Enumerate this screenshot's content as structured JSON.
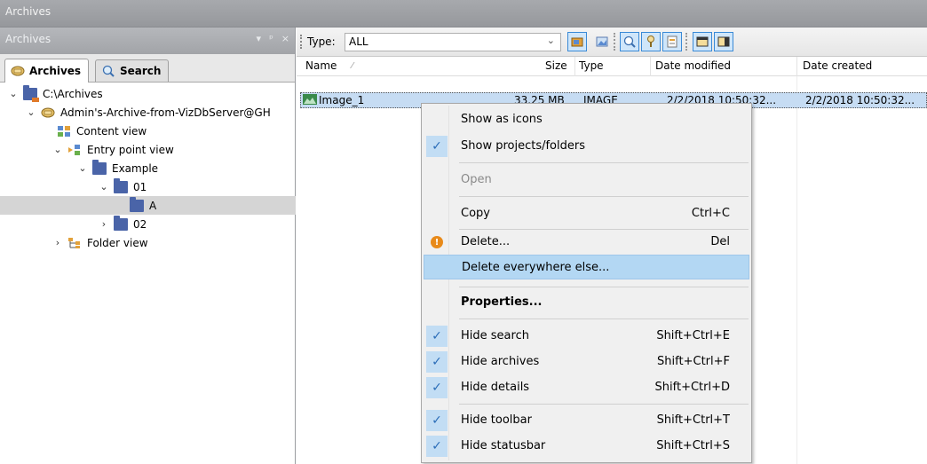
{
  "window": {
    "title": "Archives"
  },
  "left_panel": {
    "header_title": "Archives",
    "header_buttons": [
      "▾",
      "ᵖ",
      "×"
    ],
    "tabs": [
      {
        "label": "Archives",
        "icon": "archive-icon"
      },
      {
        "label": "Search",
        "icon": "search-icon"
      }
    ],
    "tree": [
      {
        "label": "C:\\Archives",
        "chevron": "⌄",
        "icon": "drive-folder-icon"
      },
      {
        "label": "Admin's-Archive-from-VizDbServer@GH",
        "chevron": "⌄",
        "icon": "archive-icon"
      },
      {
        "label": "Content view",
        "chevron": "",
        "icon": "content-view-icon"
      },
      {
        "label": "Entry point view",
        "chevron": "⌄",
        "icon": "entry-point-icon"
      },
      {
        "label": "Example",
        "chevron": "⌄",
        "icon": "folder-icon"
      },
      {
        "label": "01",
        "chevron": "⌄",
        "icon": "folder-icon"
      },
      {
        "label": "A",
        "chevron": "",
        "icon": "folder-icon",
        "selected": true
      },
      {
        "label": "02",
        "chevron": "›",
        "icon": "folder-icon"
      },
      {
        "label": "Folder view",
        "chevron": "›",
        "icon": "folder-view-icon"
      }
    ]
  },
  "toolbar": {
    "type_label": "Type:",
    "type_value": "ALL",
    "buttons": [
      "show-projects-icon",
      "thumbnail-icon",
      "search-icon",
      "filter-icon",
      "properties-icon",
      "hide-archives-icon",
      "hide-details-icon"
    ]
  },
  "columns": {
    "name": "Name",
    "size": "Size",
    "type": "Type",
    "date_modified": "Date modified",
    "date_created": "Date created"
  },
  "files": [
    {
      "name": "Image_1",
      "size": "33.25 MB",
      "type": "IMAGE",
      "date_modified": "2/2/2018 10:50:32...",
      "date_created": "2/2/2018 10:50:32..."
    }
  ],
  "context_menu": {
    "items": [
      {
        "label": "Show as icons",
        "shortcut": "",
        "checked": false
      },
      {
        "label": "Show projects/folders",
        "shortcut": "",
        "checked": true
      },
      {
        "label": "Open",
        "shortcut": "",
        "checked": false,
        "disabled": true
      },
      {
        "label": "Copy",
        "shortcut": "Ctrl+C",
        "checked": false
      },
      {
        "label": "Delete...",
        "shortcut": "Del",
        "checked": false,
        "icon": "delete-icon"
      },
      {
        "label": "Delete everywhere else...",
        "shortcut": "",
        "checked": false,
        "hover": true
      },
      {
        "label": "Properties...",
        "shortcut": "",
        "checked": false,
        "bold": true
      },
      {
        "label": "Hide search",
        "shortcut": "Shift+Ctrl+E",
        "checked": true
      },
      {
        "label": "Hide archives",
        "shortcut": "Shift+Ctrl+F",
        "checked": true
      },
      {
        "label": "Hide details",
        "shortcut": "Shift+Ctrl+D",
        "checked": true
      },
      {
        "label": "Hide toolbar",
        "shortcut": "Shift+Ctrl+T",
        "checked": true
      },
      {
        "label": "Hide statusbar",
        "shortcut": "Shift+Ctrl+S",
        "checked": true
      }
    ]
  },
  "colors": {
    "selection": "#c6dcf3",
    "menu_hover": "#b3d7f3",
    "folder": "#4a64a8",
    "check": "#2b6db8"
  }
}
